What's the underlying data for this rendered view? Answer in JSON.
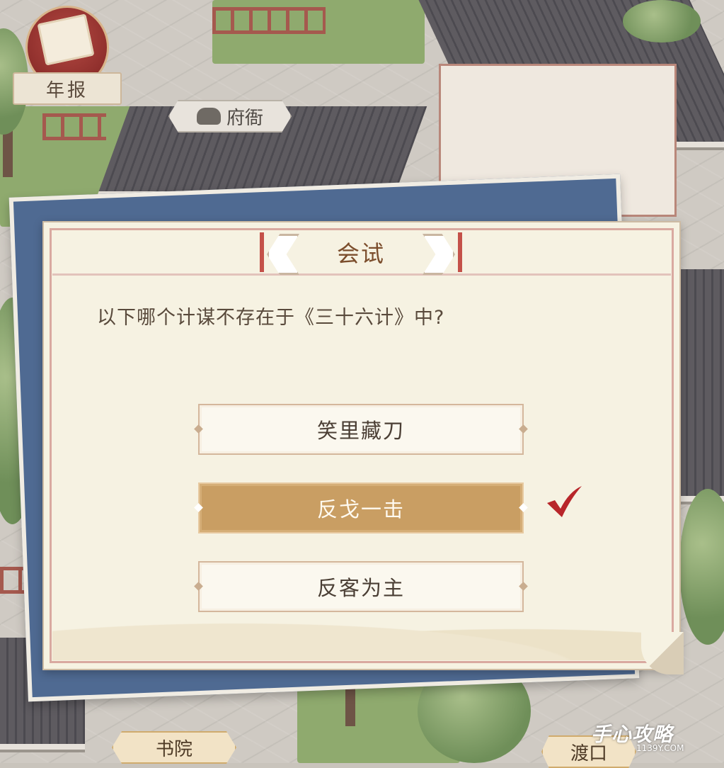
{
  "hud": {
    "annual_report_label": "年报"
  },
  "buildings": {
    "government_office": "府衙",
    "academy": "书院",
    "ferry": "渡口"
  },
  "dialog": {
    "title": "会试",
    "question": "以下哪个计谋不存在于《三十六计》中?",
    "options": [
      {
        "label": "笑里藏刀",
        "selected": false
      },
      {
        "label": "反戈一击",
        "selected": true
      },
      {
        "label": "反客为主",
        "selected": false
      }
    ],
    "answer_mark": "check-icon",
    "colors": {
      "selected_option": "#c99e63",
      "check": "#b8262a",
      "title_accent": "#c45149"
    }
  },
  "watermark": {
    "brand": "手心攻略",
    "site": "1139Y.COM"
  }
}
